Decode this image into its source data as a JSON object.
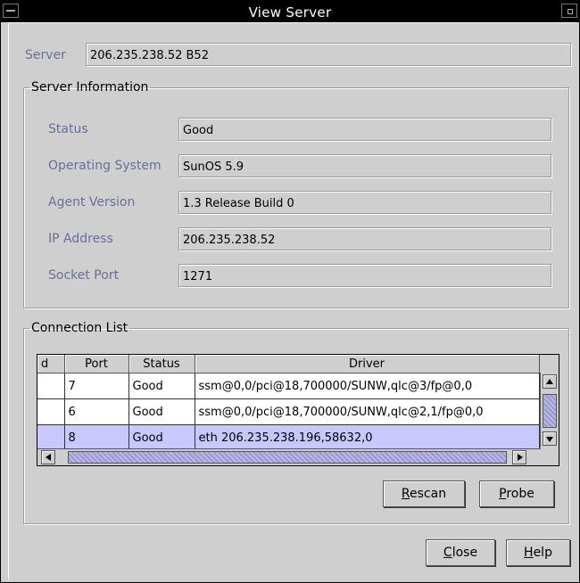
{
  "window": {
    "title": "View Server"
  },
  "server": {
    "label": "Server",
    "value": "206.235.238.52 B52"
  },
  "server_info": {
    "legend": "Server Information",
    "fields": [
      {
        "label": "Status",
        "value": "Good"
      },
      {
        "label": "Operating System",
        "value": "SunOS 5.9"
      },
      {
        "label": "Agent Version",
        "value": "1.3 Release Build 0"
      },
      {
        "label": "IP Address",
        "value": "206.235.238.52"
      },
      {
        "label": "Socket Port",
        "value": "1271"
      }
    ]
  },
  "connection_list": {
    "legend": "Connection List",
    "columns": [
      "d",
      "Port",
      "Status",
      "Driver"
    ],
    "rows": [
      {
        "d": "",
        "port": "7",
        "status": "Good",
        "driver": "ssm@0,0/pci@18,700000/SUNW,qlc@3/fp@0,0"
      },
      {
        "d": "",
        "port": "6",
        "status": "Good",
        "driver": "ssm@0,0/pci@18,700000/SUNW,qlc@2,1/fp@0,0"
      },
      {
        "d": "",
        "port": "8",
        "status": "Good",
        "driver": "eth 206.235.238.196,58632,0",
        "selected": true
      }
    ]
  },
  "buttons": {
    "rescan": {
      "mnemonic": "R",
      "rest": "escan"
    },
    "probe": {
      "mnemonic": "P",
      "rest": "robe"
    },
    "close": {
      "mnemonic": "C",
      "rest": "lose"
    },
    "help": {
      "mnemonic": "H",
      "rest": "elp"
    }
  },
  "colors": {
    "label": "#66709a",
    "selection": "#c8c8ff",
    "scroll_thumb": "#9a9acc"
  },
  "icons": [
    "window-menu-icon",
    "maximize-icon",
    "scroll-up-icon",
    "scroll-down-icon",
    "scroll-left-icon",
    "scroll-right-icon"
  ]
}
